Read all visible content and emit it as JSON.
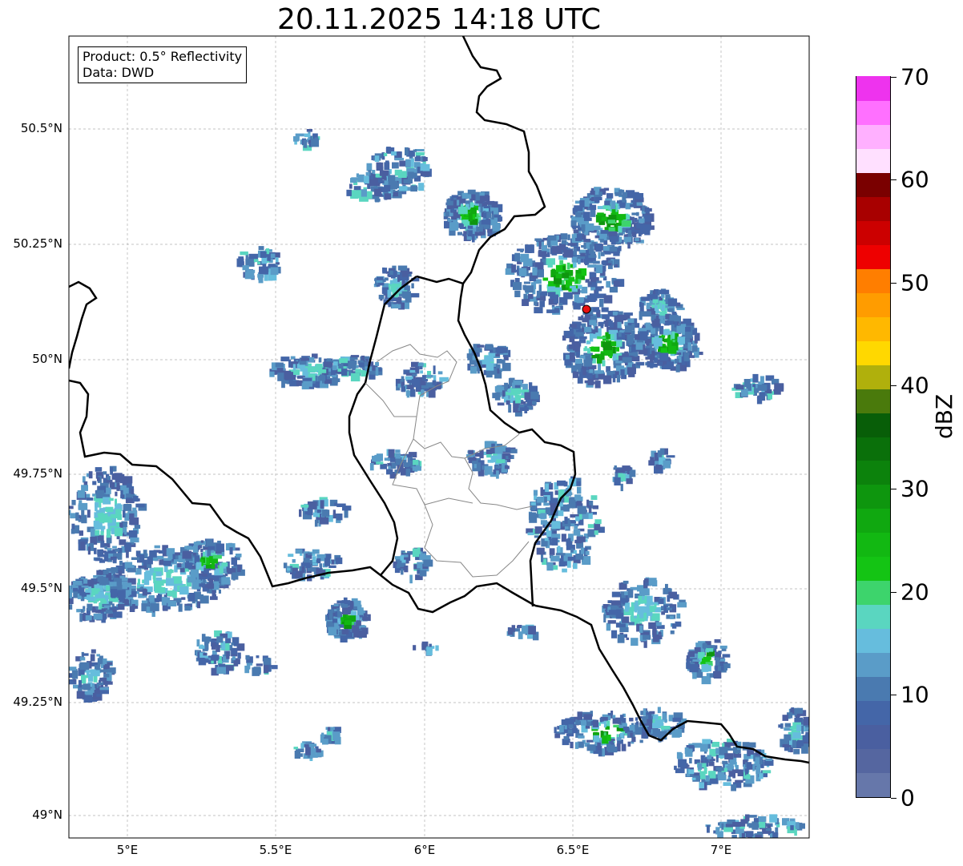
{
  "title": "20.11.2025 14:18 UTC",
  "info": {
    "line1": "Product: 0.5° Reflectivity",
    "line2": "Data: DWD"
  },
  "lat_ticks": [
    "50.5°N",
    "50.25°N",
    "50°N",
    "49.75°N",
    "49.5°N",
    "49.25°N",
    "49°N"
  ],
  "lon_ticks": [
    "5°E",
    "5.5°E",
    "6°E",
    "6.5°E",
    "7°E"
  ],
  "colorbar": {
    "label": "dBZ",
    "ticks": [
      "0",
      "10",
      "20",
      "30",
      "40",
      "50",
      "60",
      "70"
    ],
    "min": 0,
    "max": 70,
    "step": 2.5,
    "colors": [
      "#6677aa",
      "#5566a0",
      "#4a5fa0",
      "#4466a8",
      "#4a7ab0",
      "#5a9cc8",
      "#66bddd",
      "#5ad6c0",
      "#3dd46c",
      "#14c414",
      "#12b812",
      "#10a810",
      "#0e960e",
      "#0c820c",
      "#0a700a",
      "#085e08",
      "#4a7a0c",
      "#b0b00c",
      "#ffd800",
      "#ffb800",
      "#ff9c00",
      "#ff7e00",
      "#ee0000",
      "#cc0000",
      "#a80000",
      "#7a0000",
      "#ffe0ff",
      "#ffb0ff",
      "#ff70ff",
      "#ee33ee"
    ]
  },
  "colors": {
    "border": "#000000",
    "admin": "#888888",
    "grid": "#b0b0b0",
    "radar_site": "#e81010"
  },
  "map_extent": {
    "lon": [
      4.8,
      7.3
    ],
    "lat": [
      48.94,
      50.69
    ]
  }
}
